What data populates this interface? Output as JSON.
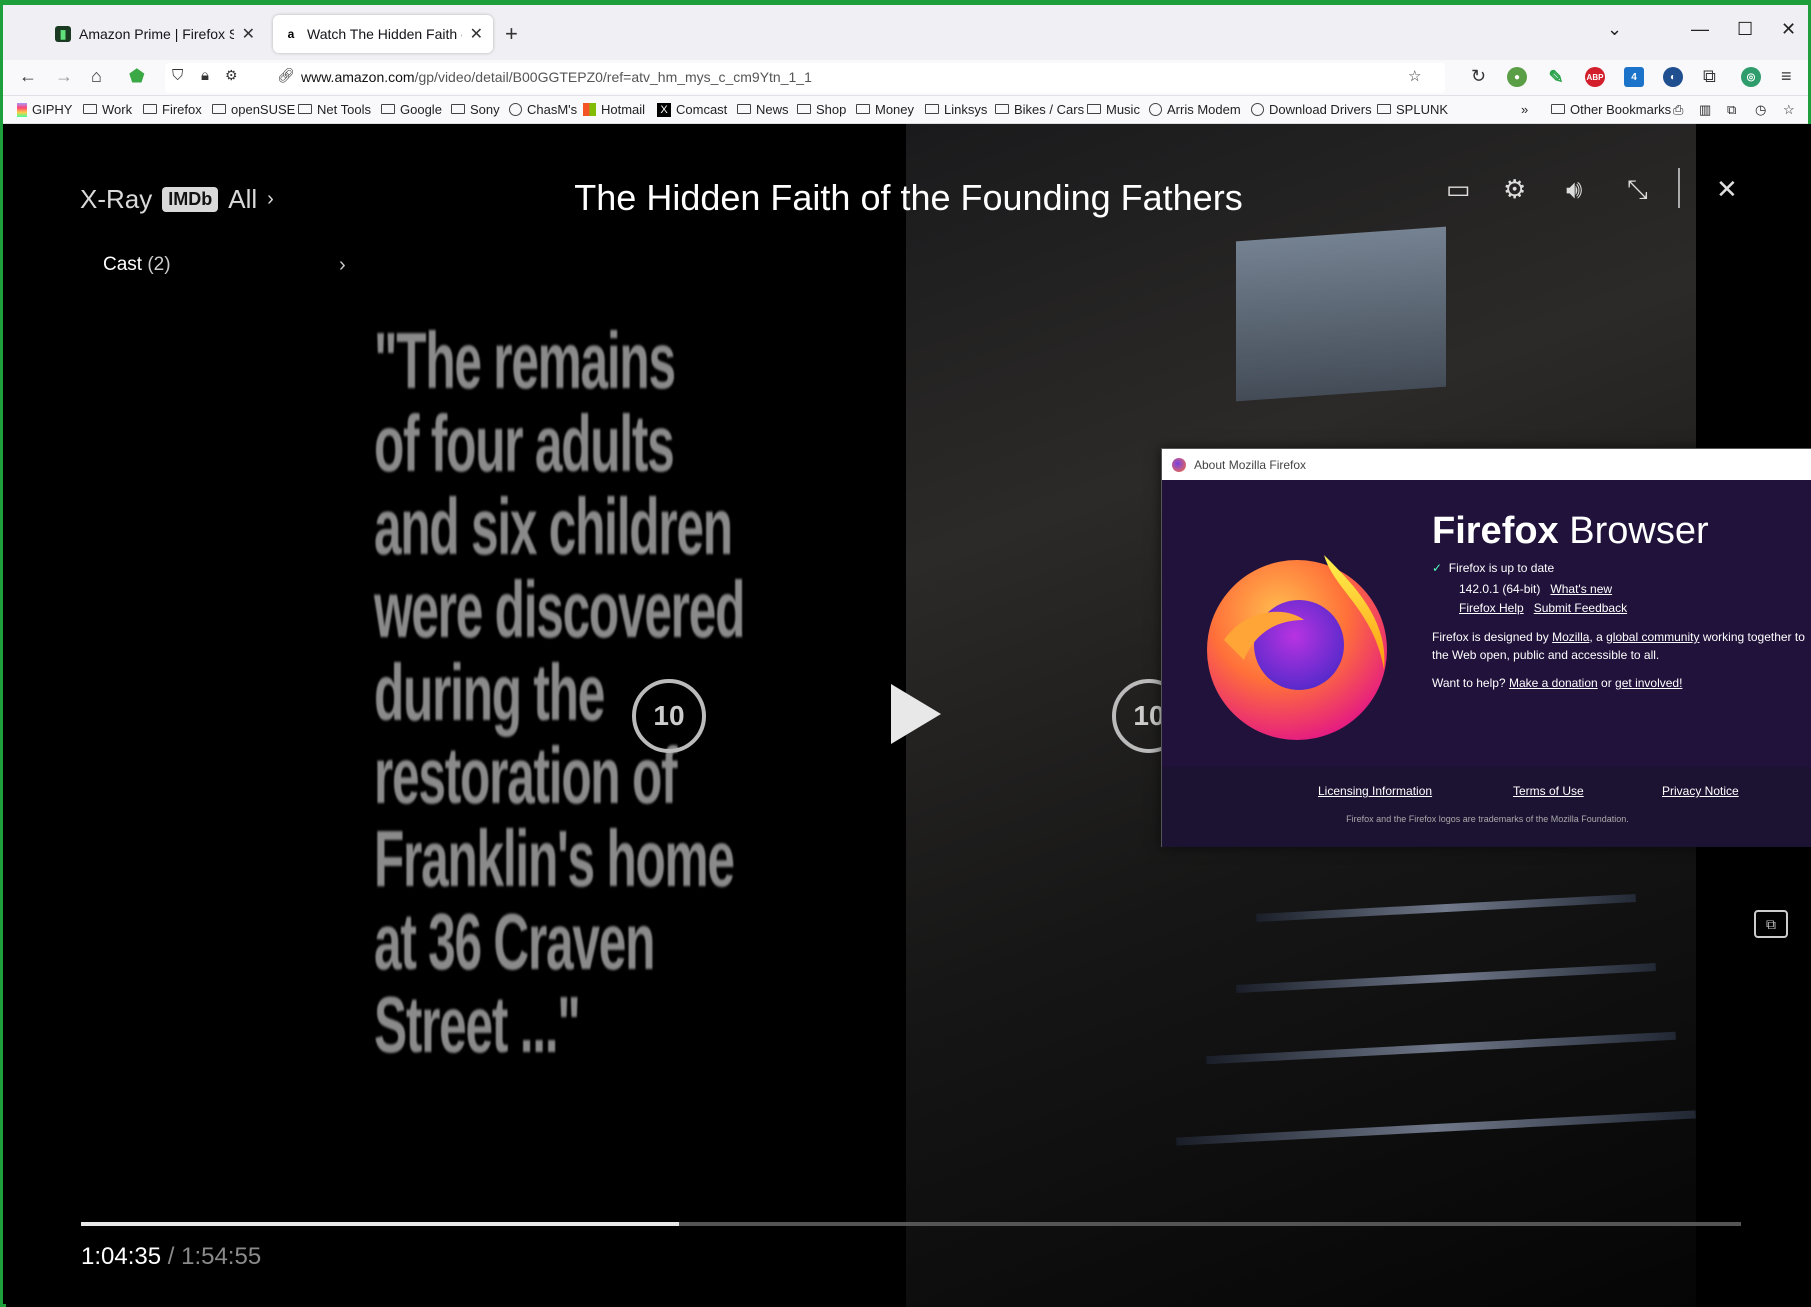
{
  "tabs": [
    {
      "title": "Amazon Prime | Firefox Support",
      "icon": "firefox-support-icon"
    },
    {
      "title": "Watch The Hidden Faith of the F",
      "icon": "amazon-icon"
    }
  ],
  "address": {
    "host": "www.amazon.com",
    "path": "/gp/video/detail/B00GGTEPZ0/ref=atv_hm_mys_c_cm9Ytn_1_1"
  },
  "extension_badge": "4",
  "abp_label": "ABP",
  "bookmarks": [
    "GIPHY",
    "Work",
    "Firefox",
    "openSUSE",
    "Net Tools",
    "Google",
    "Sony",
    "ChasM's",
    "Hotmail",
    "Comcast",
    "News",
    "Shop",
    "Money",
    "Linksys",
    "Bikes / Cars",
    "Music",
    "Arris Modem",
    "Download Drivers",
    "SPLUNK"
  ],
  "other_bookmarks": "Other Bookmarks",
  "player": {
    "xray": "X-Ray",
    "imdb": "IMDb",
    "all": "All",
    "cast_label": "Cast",
    "cast_count": "(2)",
    "title": "The Hidden Faith of the Founding Fathers",
    "quote_lines": [
      "\"The remains",
      "of four adults",
      "and six children",
      "were discovered",
      "during the",
      "restoration of",
      "Franklin's home",
      "at 36 Craven",
      "Street ...\""
    ],
    "skip_back": "10",
    "skip_forward": "10",
    "current_time": "1:04:35",
    "separator": "/",
    "total_time": "1:54:55",
    "progress_fraction": 0.36
  },
  "about": {
    "window_title": "About Mozilla Firefox",
    "brand_bold": "Firefox",
    "brand_rest": "Browser",
    "status": "Firefox is up to date",
    "version": "142.0.1 (64-bit)",
    "whats_new": "What's new",
    "help": "Firefox Help",
    "feedback": "Submit Feedback",
    "designed_1": "Firefox is designed by",
    "mozilla": "Mozilla",
    "designed_2": ", a",
    "global_community": "global community",
    "designed_3": "working together to",
    "designed_4": "the Web open, public and accessible to all.",
    "want_help": "Want to help?",
    "donation": "Make a donation",
    "or": "or",
    "involved": "get involved!",
    "licensing": "Licensing Information",
    "terms": "Terms of Use",
    "privacy": "Privacy Notice",
    "trademark": "Firefox and the Firefox logos are trademarks of the Mozilla Foundation."
  },
  "colors": {
    "frame_green": "#1f9e3c",
    "about_bg": "#20123a"
  }
}
